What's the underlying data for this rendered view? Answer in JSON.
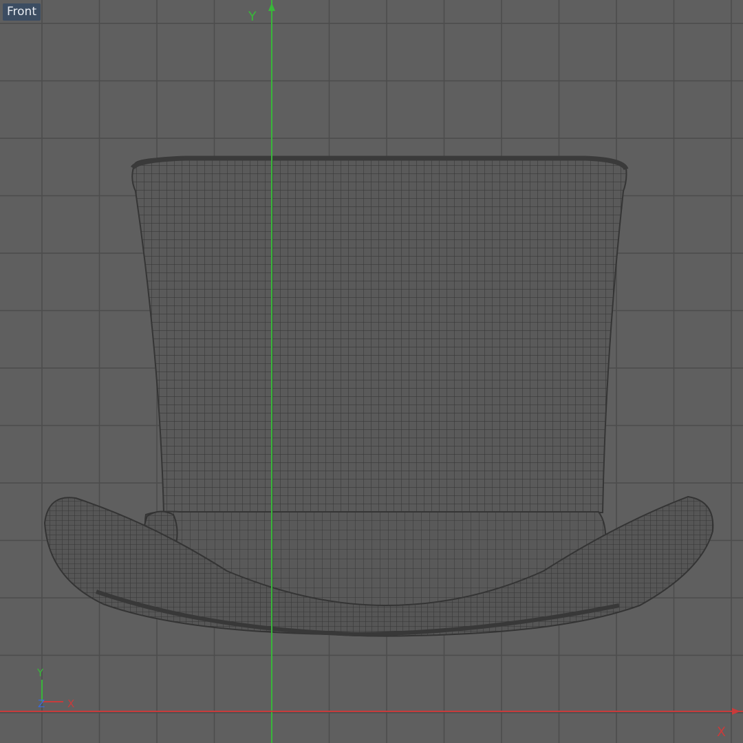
{
  "viewport": {
    "view_name": "Front",
    "axis_y_label": "Y",
    "axis_x_label": "X"
  },
  "gizmo": {
    "y_label": "Y",
    "z_label": "Z",
    "x_label": "X"
  },
  "model": {
    "name": "top-hat-wireframe"
  },
  "colors": {
    "background": "#5f5f5f",
    "grid": "#4e4e4e",
    "wire": "#3a3a3a",
    "axis_y": "#39b63a",
    "axis_x": "#c93b3b",
    "axis_z": "#3a6bd8",
    "label_bg": "#3c4d62"
  }
}
